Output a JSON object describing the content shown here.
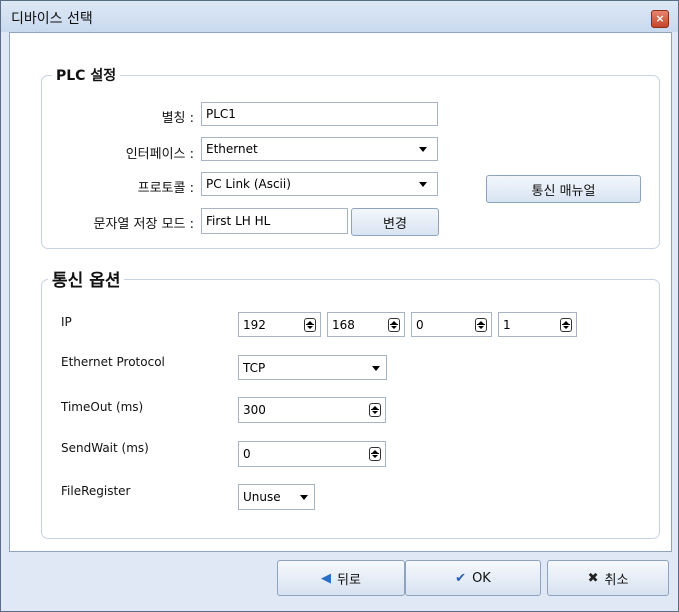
{
  "window": {
    "title": "디바이스 선택",
    "close_icon": "close-icon"
  },
  "plc_group": {
    "title": "PLC 설정",
    "alias_label": "별칭 :",
    "alias_value": "PLC1",
    "interface_label": "인터페이스 :",
    "interface_value": "Ethernet",
    "protocol_label": "프로토콜 :",
    "protocol_value": "PC Link (Ascii)",
    "manual_button": "통신 매뉴얼",
    "string_mode_label": "문자열 저장 모드 :",
    "string_mode_value": "First LH HL",
    "change_button": "변경"
  },
  "comm_group": {
    "title": "통신 옵션",
    "ip_label": "IP",
    "ip": [
      "192",
      "168",
      "0",
      "1"
    ],
    "eth_protocol_label": "Ethernet Protocol",
    "eth_protocol_value": "TCP",
    "timeout_label": "TimeOut (ms)",
    "timeout_value": "300",
    "sendwait_label": "SendWait (ms)",
    "sendwait_value": "0",
    "fileregister_label": "FileRegister",
    "fileregister_value": "Unuse"
  },
  "footer": {
    "back_label": "뒤로",
    "ok_label": "OK",
    "cancel_label": "취소"
  },
  "colors": {
    "back_arrow": "#2a6fc4",
    "ok_check": "#2b5fb3",
    "cancel_x": "#222222"
  }
}
